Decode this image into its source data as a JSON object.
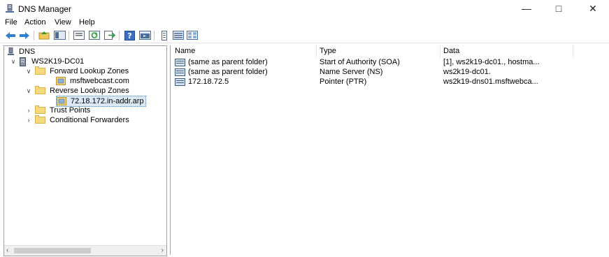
{
  "window": {
    "title": "DNS Manager"
  },
  "menu": [
    "File",
    "Action",
    "View",
    "Help"
  ],
  "tree": {
    "root": "DNS",
    "server": "WS2K19-DC01",
    "forward": "Forward Lookup Zones",
    "forward_zone": "msftwebcast.com",
    "reverse": "Reverse Lookup Zones",
    "reverse_zone": "72.18.172.in-addr.arp",
    "trust": "Trust Points",
    "conditional": "Conditional Forwarders"
  },
  "list": {
    "columns": [
      "Name",
      "Type",
      "Data"
    ],
    "rows": [
      {
        "name": "(same as parent folder)",
        "type": "Start of Authority (SOA)",
        "data": "[1], ws2k19-dc01., hostma..."
      },
      {
        "name": "(same as parent folder)",
        "type": "Name Server (NS)",
        "data": "ws2k19-dc01."
      },
      {
        "name": "172.18.72.5",
        "type": "Pointer (PTR)",
        "data": "ws2k19-dns01.msftwebca..."
      }
    ]
  },
  "icons": [
    "back-arrow-icon",
    "forward-arrow-icon",
    "up-folder-icon",
    "show-tree-icon",
    "properties-icon",
    "refresh-icon",
    "export-icon",
    "help-icon",
    "console-icon",
    "record-icon",
    "list-icon",
    "details-icon"
  ]
}
